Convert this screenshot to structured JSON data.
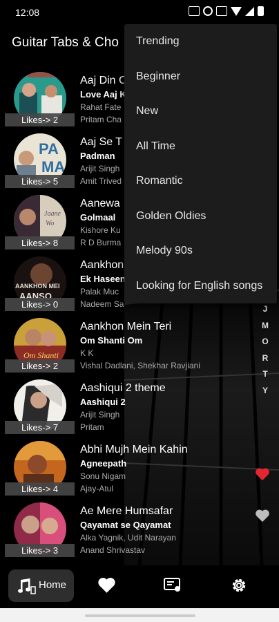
{
  "status": {
    "time": "12:08",
    "icons": [
      "vpn-box-icon",
      "alarm-icon",
      "message-icon",
      "wifi-icon",
      "signal-icon",
      "battery-icon"
    ]
  },
  "app_bar": {
    "title": "Guitar Tabs & Cho"
  },
  "menu": {
    "items": [
      {
        "label": "Trending"
      },
      {
        "label": "Beginner"
      },
      {
        "label": "New"
      },
      {
        "label": "All Time"
      },
      {
        "label": "Romantic"
      },
      {
        "label": "Golden Oldies"
      },
      {
        "label": "Melody 90s"
      },
      {
        "label": "Looking for English songs"
      }
    ]
  },
  "songs": [
    {
      "title": "Aaj Din C",
      "album": "Love Aaj K",
      "singer": "Rahat Fate",
      "music": "Pritam Cha",
      "likes": "Likes-> 2",
      "favorite": null
    },
    {
      "title": "Aaj Se T",
      "album": "Padman",
      "singer": "Arijit Singh",
      "music": "Amit Trived",
      "likes": "Likes-> 5",
      "favorite": null
    },
    {
      "title": "Aanewa",
      "album": "Golmaal",
      "singer": "Kishore Ku",
      "music": "R D Burma",
      "likes": "Likes-> 8",
      "favorite": null
    },
    {
      "title": "Aankhon",
      "album": "Ek Haseen",
      "singer": "Palak Muc",
      "music": "Nadeem Sa",
      "likes": "Likes-> 0",
      "favorite": null
    },
    {
      "title": "Aankhon Mein Teri",
      "album": "Om Shanti Om",
      "singer": "K K",
      "music": "Vishal Dadlani, Shekhar Ravjiani",
      "likes": "Likes-> 2",
      "favorite": null
    },
    {
      "title": "Aashiqui 2 theme",
      "album": "Aashiqui 2",
      "singer": "Arijit Singh",
      "music": "Pritam",
      "likes": "Likes-> 7",
      "favorite": null
    },
    {
      "title": "Abhi Mujh Mein Kahin",
      "album": "Agneepath",
      "singer": "Sonu Nigam",
      "music": "Ajay-Atul",
      "likes": "Likes-> 4",
      "favorite": true
    },
    {
      "title": "Ae Mere Humsafar",
      "album": "Qayamat se Qayamat",
      "singer": "Alka Yagnik, Udit Narayan",
      "music": "Anand Shrivastav",
      "likes": "Likes-> 3",
      "favorite": false
    }
  ],
  "alpha_index": [
    "J",
    "M",
    "O",
    "R",
    "T",
    "Y"
  ],
  "bottom_nav": {
    "home_label": "Home"
  },
  "colors": {
    "favorite_on": "#e3262f",
    "favorite_off": "#bdbdbd",
    "menu_bg": "#1c1c1c"
  }
}
